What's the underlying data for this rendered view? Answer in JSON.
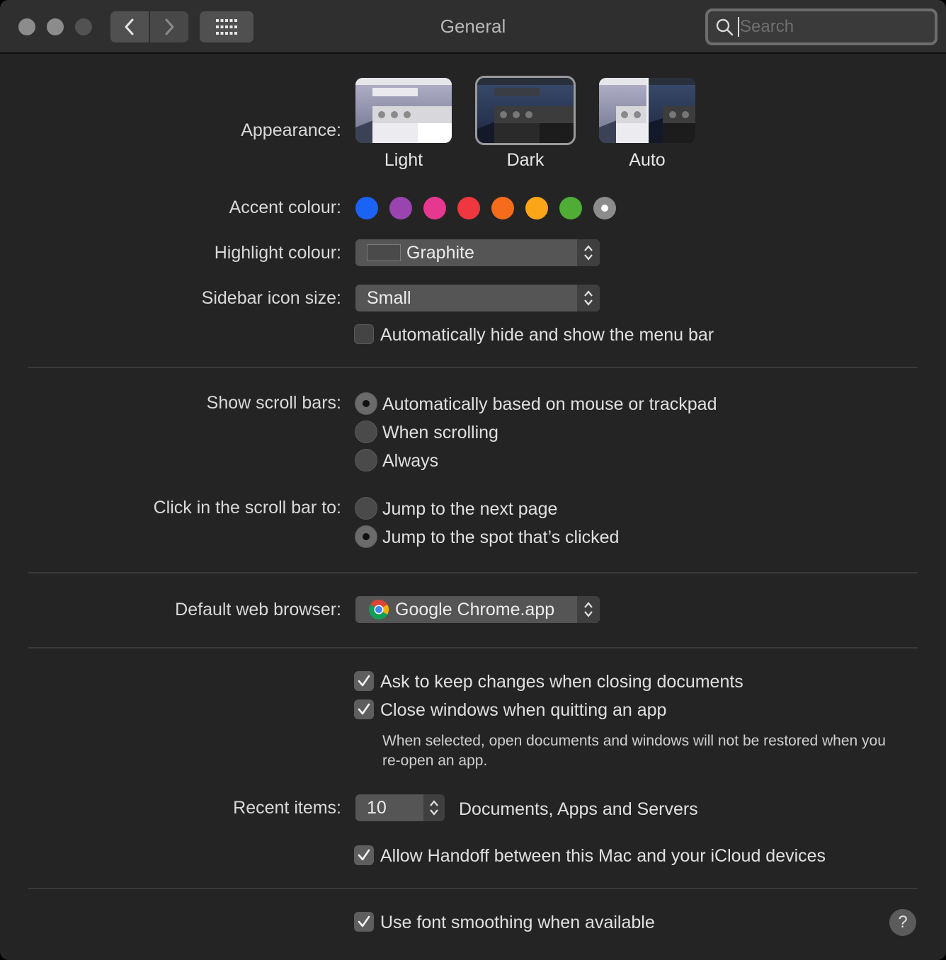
{
  "window": {
    "title": "General",
    "search_placeholder": "Search"
  },
  "appearance": {
    "label": "Appearance:",
    "options": [
      {
        "name": "Light",
        "selected": false
      },
      {
        "name": "Dark",
        "selected": true
      },
      {
        "name": "Auto",
        "selected": false
      }
    ]
  },
  "accent": {
    "label": "Accent colour:",
    "colors": [
      "#1b63f5",
      "#9a44b0",
      "#e6388e",
      "#f0363f",
      "#f46c1c",
      "#fba619",
      "#4fac35",
      "#8c8c8c"
    ],
    "selected_index": 7
  },
  "highlight": {
    "label": "Highlight colour:",
    "value": "Graphite"
  },
  "sidebar_icon": {
    "label": "Sidebar icon size:",
    "value": "Small"
  },
  "menu_bar": {
    "label": "Automatically hide and show the menu bar",
    "checked": false
  },
  "scroll_bars": {
    "label": "Show scroll bars:",
    "options": [
      {
        "text": "Automatically based on mouse or trackpad",
        "selected": true
      },
      {
        "text": "When scrolling",
        "selected": false
      },
      {
        "text": "Always",
        "selected": false
      }
    ]
  },
  "click_scroll": {
    "label": "Click in the scroll bar to:",
    "options": [
      {
        "text": "Jump to the next page",
        "selected": false
      },
      {
        "text": "Jump to the spot that’s clicked",
        "selected": true
      }
    ]
  },
  "browser": {
    "label": "Default web browser:",
    "value": "Google Chrome.app"
  },
  "documents": {
    "ask_keep": "Ask to keep changes when closing documents",
    "close_windows": "Close windows when quitting an app",
    "note": "When selected, open documents and windows will not be restored when you re-open an app."
  },
  "recent": {
    "label": "Recent items:",
    "value": "10",
    "suffix": "Documents, Apps and Servers"
  },
  "handoff": {
    "label": "Allow Handoff between this Mac and your iCloud devices"
  },
  "font_smoothing": {
    "label": "Use font smoothing when available"
  },
  "help": {
    "label": "?"
  }
}
